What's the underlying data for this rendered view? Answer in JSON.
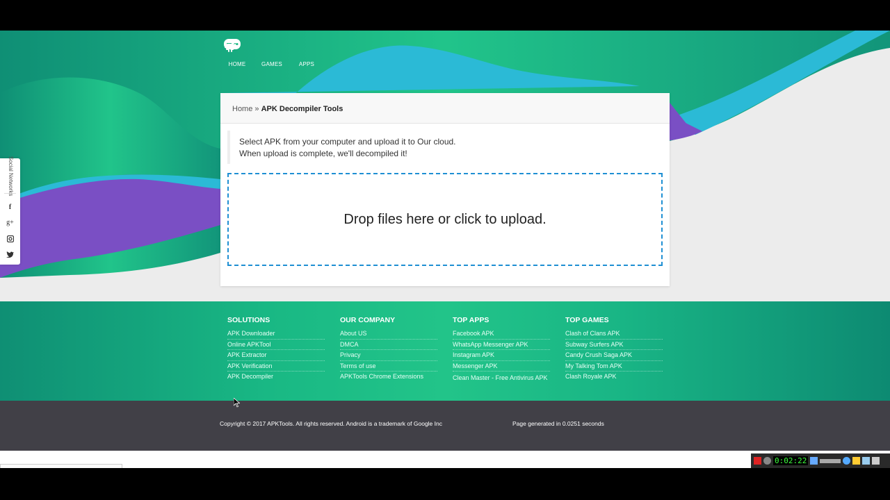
{
  "nav": [
    {
      "label": "HOME",
      "icon": "home-icon"
    },
    {
      "label": "GAMES",
      "icon": "gamepad-icon"
    },
    {
      "label": "APPS",
      "icon": "android-icon"
    }
  ],
  "social": {
    "title": "Social Networks",
    "icons": [
      "facebook-icon",
      "google-plus-icon",
      "instagram-icon",
      "twitter-icon"
    ]
  },
  "breadcrumb": {
    "home": "Home",
    "separator": "»",
    "current": "APK Decompiler Tools"
  },
  "note": {
    "line1": "Select APK from your computer and upload it to Our cloud.",
    "line2": "When upload is complete, we'll decompiled it!"
  },
  "dropzone": {
    "text": "Drop files here or click to upload."
  },
  "footer": {
    "columns": [
      {
        "heading": "SOLUTIONS",
        "links": [
          "APK Downloader",
          "Online APKTool",
          "APK Extractor",
          "APK Verification",
          "APK Decompiler"
        ]
      },
      {
        "heading": "OUR COMPANY",
        "links": [
          "About US",
          "DMCA",
          "Privacy",
          "Terms of use",
          "APKTools Chrome Extensions"
        ]
      },
      {
        "heading": "TOP APPS",
        "links": [
          "Facebook APK",
          "WhatsApp Messenger APK",
          "Instagram APK",
          "Messenger APK",
          "Clean Master - Free Antivirus APK"
        ]
      },
      {
        "heading": "TOP GAMES",
        "links": [
          "Clash of Clans APK",
          "Subway Surfers APK",
          "Candy Crush Saga APK",
          "My Talking Tom APK",
          "Clash Royale APK"
        ]
      }
    ],
    "copyright": "Copyright © 2017 APKTools. All rights reserved. Android is a trademark of Google Inc",
    "generated": "Page generated in 0.0251 seconds"
  },
  "tray": {
    "clock": "0:02:22"
  },
  "colors": {
    "brand_green": "#19b884",
    "accent_blue": "#2bbad6",
    "accent_purple": "#7a4fc4",
    "dropzone_border": "#1e8fd3",
    "bottom_bar": "#414047"
  }
}
